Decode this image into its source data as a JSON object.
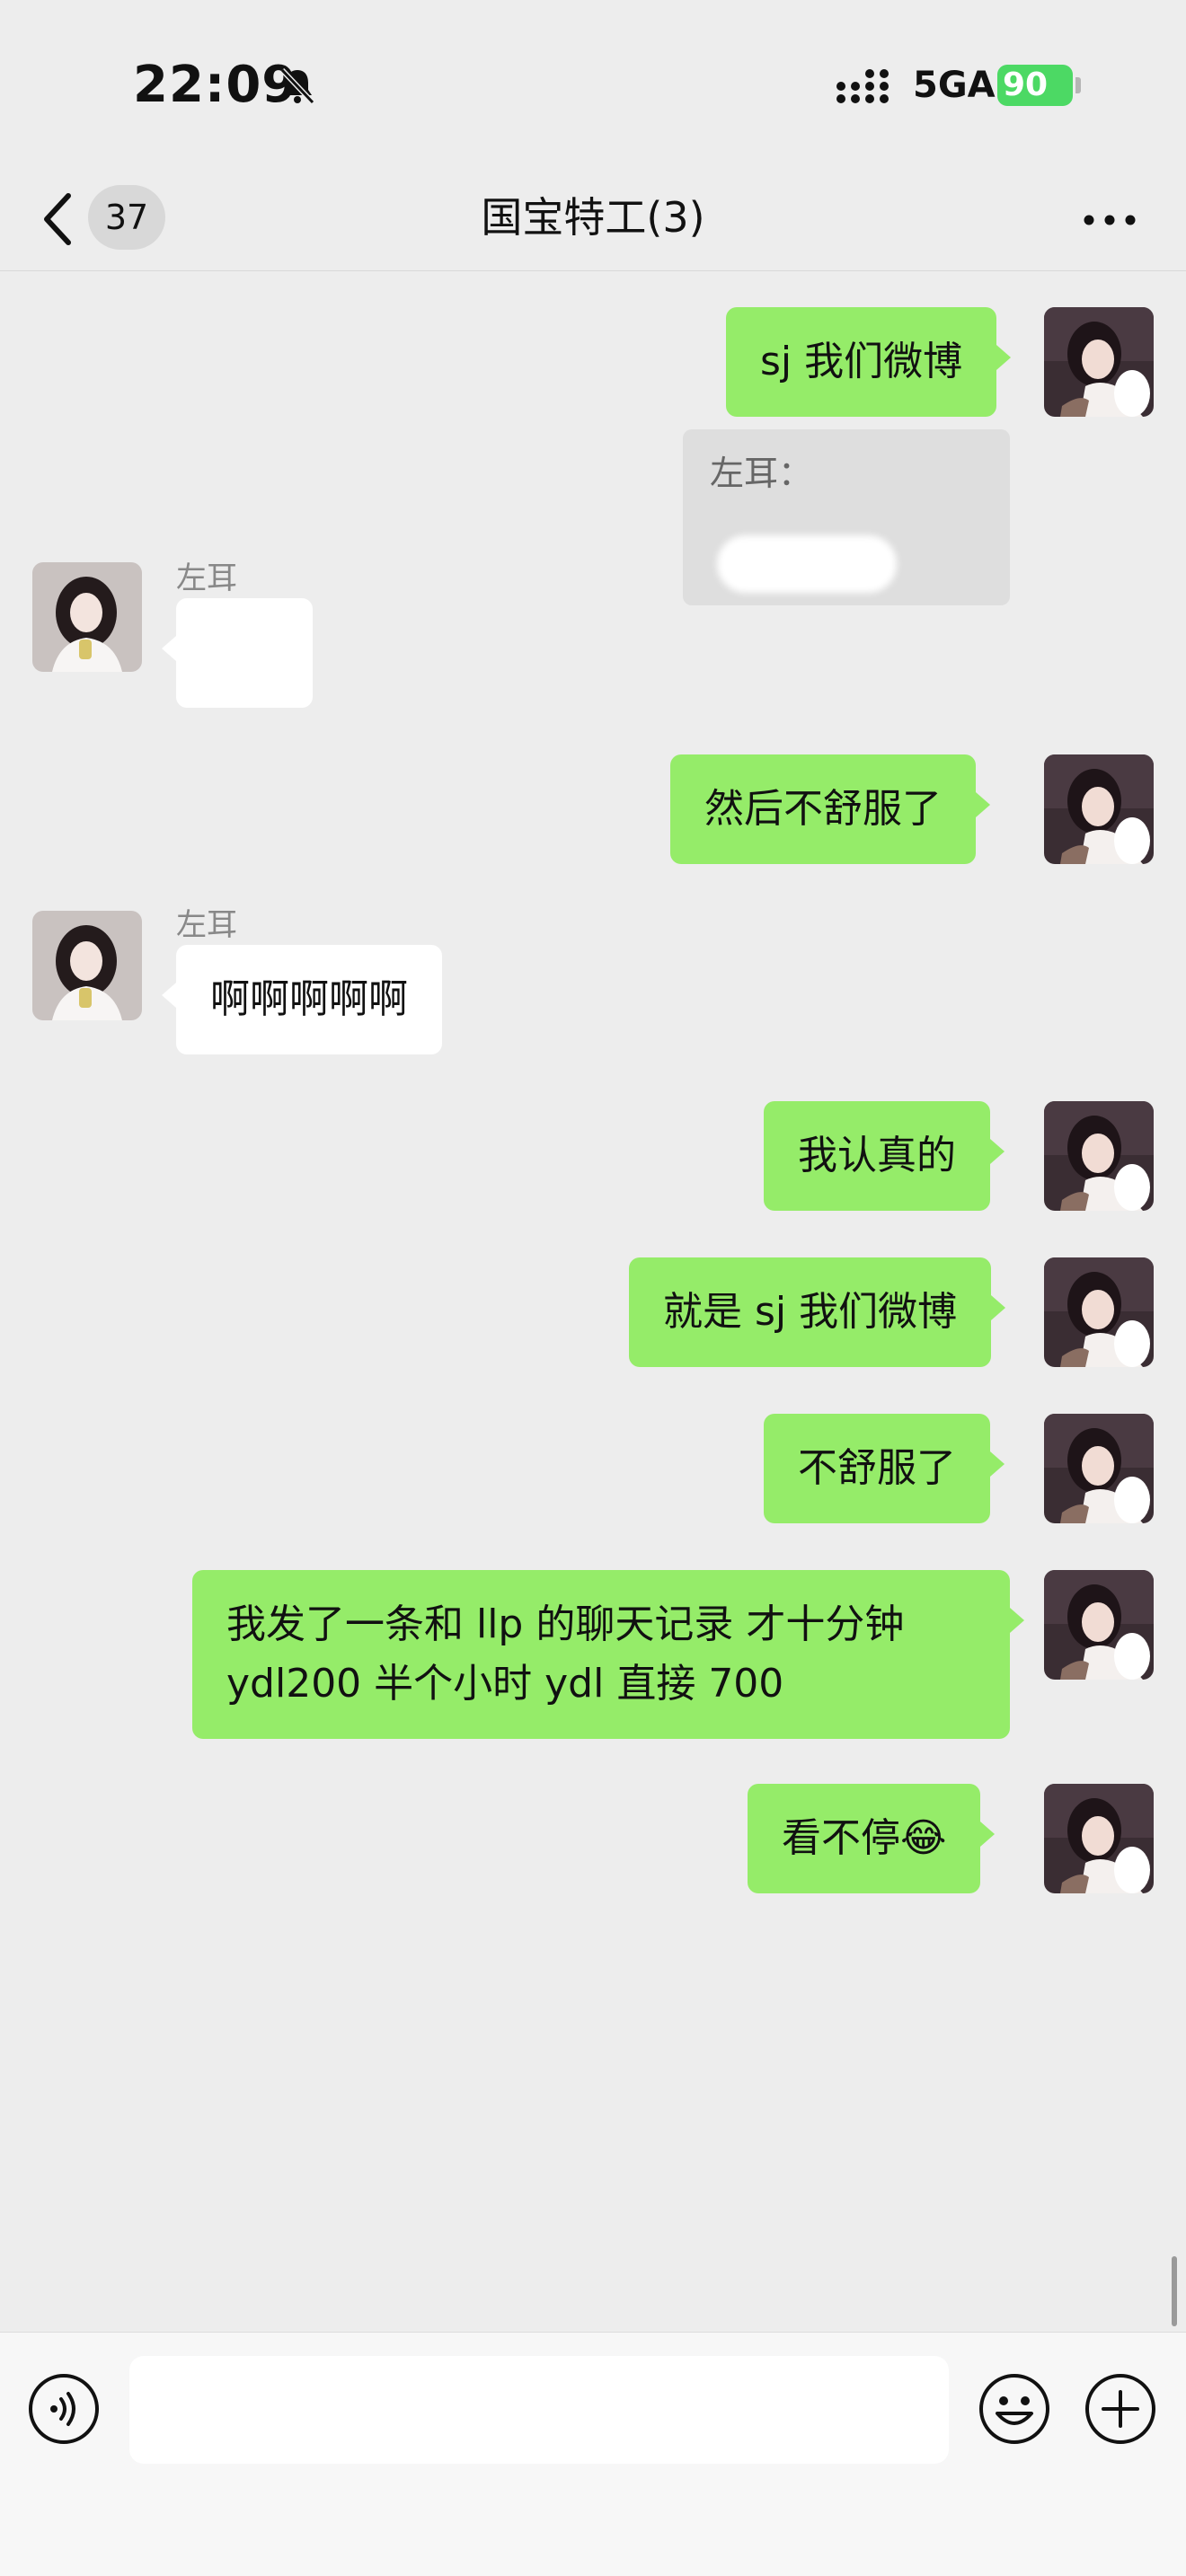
{
  "status_bar": {
    "time": "22:09",
    "network": "5GA",
    "battery": "90"
  },
  "nav": {
    "unread_count": "37",
    "title": "国宝特工(3)"
  },
  "quote": {
    "prefix": "左耳："
  },
  "messages": [
    {
      "from": "me",
      "text": "sj 我们微博"
    },
    {
      "from": "other",
      "sender": "左耳",
      "text": ""
    },
    {
      "from": "me",
      "text": "然后不舒服了"
    },
    {
      "from": "other",
      "sender": "左耳",
      "text": "啊啊啊啊啊"
    },
    {
      "from": "me",
      "text": "我认真的"
    },
    {
      "from": "me",
      "text": "就是 sj 我们微博"
    },
    {
      "from": "me",
      "text": "不舒服了"
    },
    {
      "from": "me",
      "lines": [
        "我发了一条和 llp 的聊天记录 才十分钟",
        "ydl200 半个小时 ydl 直接 700"
      ]
    },
    {
      "from": "me",
      "text": "看不停😂"
    }
  ],
  "input": {
    "placeholder": ""
  },
  "icons": {
    "back": "chevron-left-icon",
    "more": "more-dots-icon",
    "voice": "voice-icon",
    "emoji": "emoji-icon",
    "plus": "plus-icon",
    "mute": "bell-slash-icon",
    "signal": "signal-icon"
  },
  "colors": {
    "outgoing_bubble": "#95ec69",
    "incoming_bubble": "#ffffff",
    "background": "#ededed",
    "battery": "#4cd964"
  }
}
